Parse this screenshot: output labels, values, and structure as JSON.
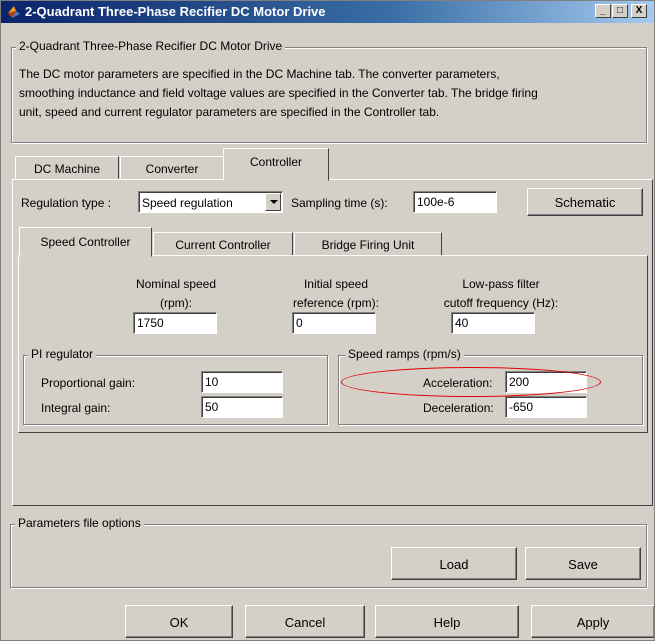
{
  "window": {
    "title": "2-Quadrant Three-Phase Recifier DC Motor Drive",
    "minimize_glyph": "_",
    "maximize_glyph": "□",
    "close_glyph": "X"
  },
  "main_group": {
    "legend": "2-Quadrant Three-Phase Recifier DC Motor Drive",
    "description_lines": [
      "The DC motor parameters are specified in the DC Machine tab. The converter parameters,",
      "smoothing inductance and field voltage values are specified in the Converter tab. The bridge firing",
      "unit, speed and current regulator parameters are specified in the Controller tab."
    ]
  },
  "main_tabs": [
    "DC Machine",
    "Converter",
    "Controller"
  ],
  "controller": {
    "regulation_label": "Regulation type :",
    "regulation_value": "Speed regulation",
    "sampling_label": "Sampling time (s):",
    "sampling_value": "100e-6",
    "schematic_label": "Schematic"
  },
  "sub_tabs": [
    "Speed Controller",
    "Current Controller",
    "Bridge Firing Unit"
  ],
  "speed_controller": {
    "nominal_label_1": "Nominal speed",
    "nominal_label_2": "(rpm):",
    "nominal_value": "1750",
    "initial_label_1": "Initial speed",
    "initial_label_2": "reference (rpm):",
    "initial_value": "0",
    "lowpass_label_1": "Low-pass filter",
    "lowpass_label_2": "cutoff frequency (Hz):",
    "lowpass_value": "40",
    "pi_legend": "PI regulator",
    "proportional_label": "Proportional gain:",
    "proportional_value": "10",
    "integral_label": "Integral gain:",
    "integral_value": "50",
    "ramps_legend": "Speed ramps (rpm/s)",
    "acceleration_label": "Acceleration:",
    "acceleration_value": "200",
    "deceleration_label": "Deceleration:",
    "deceleration_value": "-650"
  },
  "params_file": {
    "legend": "Parameters file options",
    "load_label": "Load",
    "save_label": "Save"
  },
  "dialog_buttons": {
    "ok": "OK",
    "cancel": "Cancel",
    "help": "Help",
    "apply": "Apply"
  },
  "colors": {
    "title_gradient_start": "#0a246a",
    "title_gradient_end": "#a6caf0",
    "dialog_face": "#d4d0c8",
    "highlight_ellipse": "#e00000"
  },
  "icons": {
    "title_icon": "simulink-logo-icon",
    "dropdown_icon": "chevron-down-icon"
  }
}
